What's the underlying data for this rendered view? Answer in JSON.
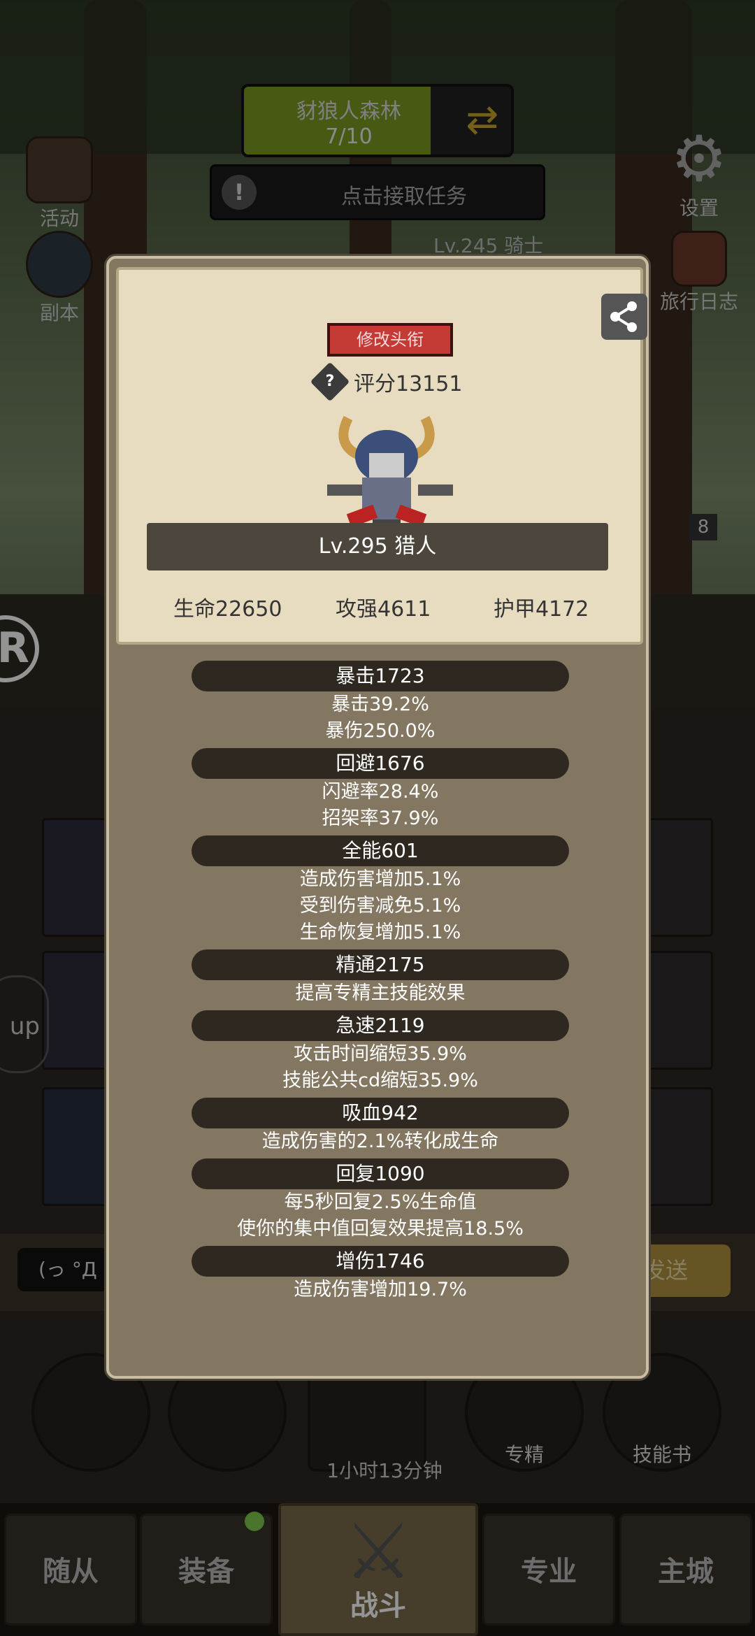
{
  "hud": {
    "stage_name": "豺狼人森林",
    "stage_progress": "7/10",
    "stage_fill": 0.7,
    "quest_text": "点击接取任务",
    "activity_label": "活动",
    "dungeon_label": "副本",
    "settings_label": "设置",
    "travel_log_label": "旅行日志",
    "chat_line": "Lv.245 骑士",
    "level_badge": "8"
  },
  "modal": {
    "change_title_button": "修改头衔",
    "score_label": "评分13151",
    "hero_line": "Lv.295 猎人",
    "base_stats": {
      "hp": "生命22650",
      "attack": "攻强4611",
      "armor": "护甲4172"
    },
    "sections": [
      {
        "title": "暴击1723",
        "lines": [
          "暴击39.2%",
          "暴伤250.0%"
        ]
      },
      {
        "title": "回避1676",
        "lines": [
          "闪避率28.4%",
          "招架率37.9%"
        ]
      },
      {
        "title": "全能601",
        "lines": [
          "造成伤害增加5.1%",
          "受到伤害减免5.1%",
          "生命恢复增加5.1%"
        ]
      },
      {
        "title": "精通2175",
        "lines": [
          "提高专精主技能效果"
        ]
      },
      {
        "title": "急速2119",
        "lines": [
          "攻击时间缩短35.9%",
          "技能公共cd缩短35.9%"
        ]
      },
      {
        "title": "吸血942",
        "lines": [
          "造成伤害的2.1%转化成生命"
        ]
      },
      {
        "title": "回复1090",
        "lines": [
          "每5秒回复2.5%生命值",
          "使你的集中值回复效果提高18.5%"
        ]
      },
      {
        "title": "增伤1746",
        "lines": [
          "造成伤害增加19.7%"
        ]
      }
    ]
  },
  "chat": {
    "input_text": "(っ °Д °",
    "send_label": "发送"
  },
  "actions": {
    "specialization_label": "专精",
    "skill_book_label": "技能书",
    "timer": "1小时13分钟"
  },
  "tabs": {
    "followers": "随从",
    "equipment": "装备",
    "battle": "战斗",
    "profession": "专业",
    "main_city": "主城"
  },
  "colors": {
    "accent_red": "#c43a35",
    "parchment": "#e7dcc0",
    "panel": "#847762",
    "stage_green": "#7b9a1f"
  }
}
